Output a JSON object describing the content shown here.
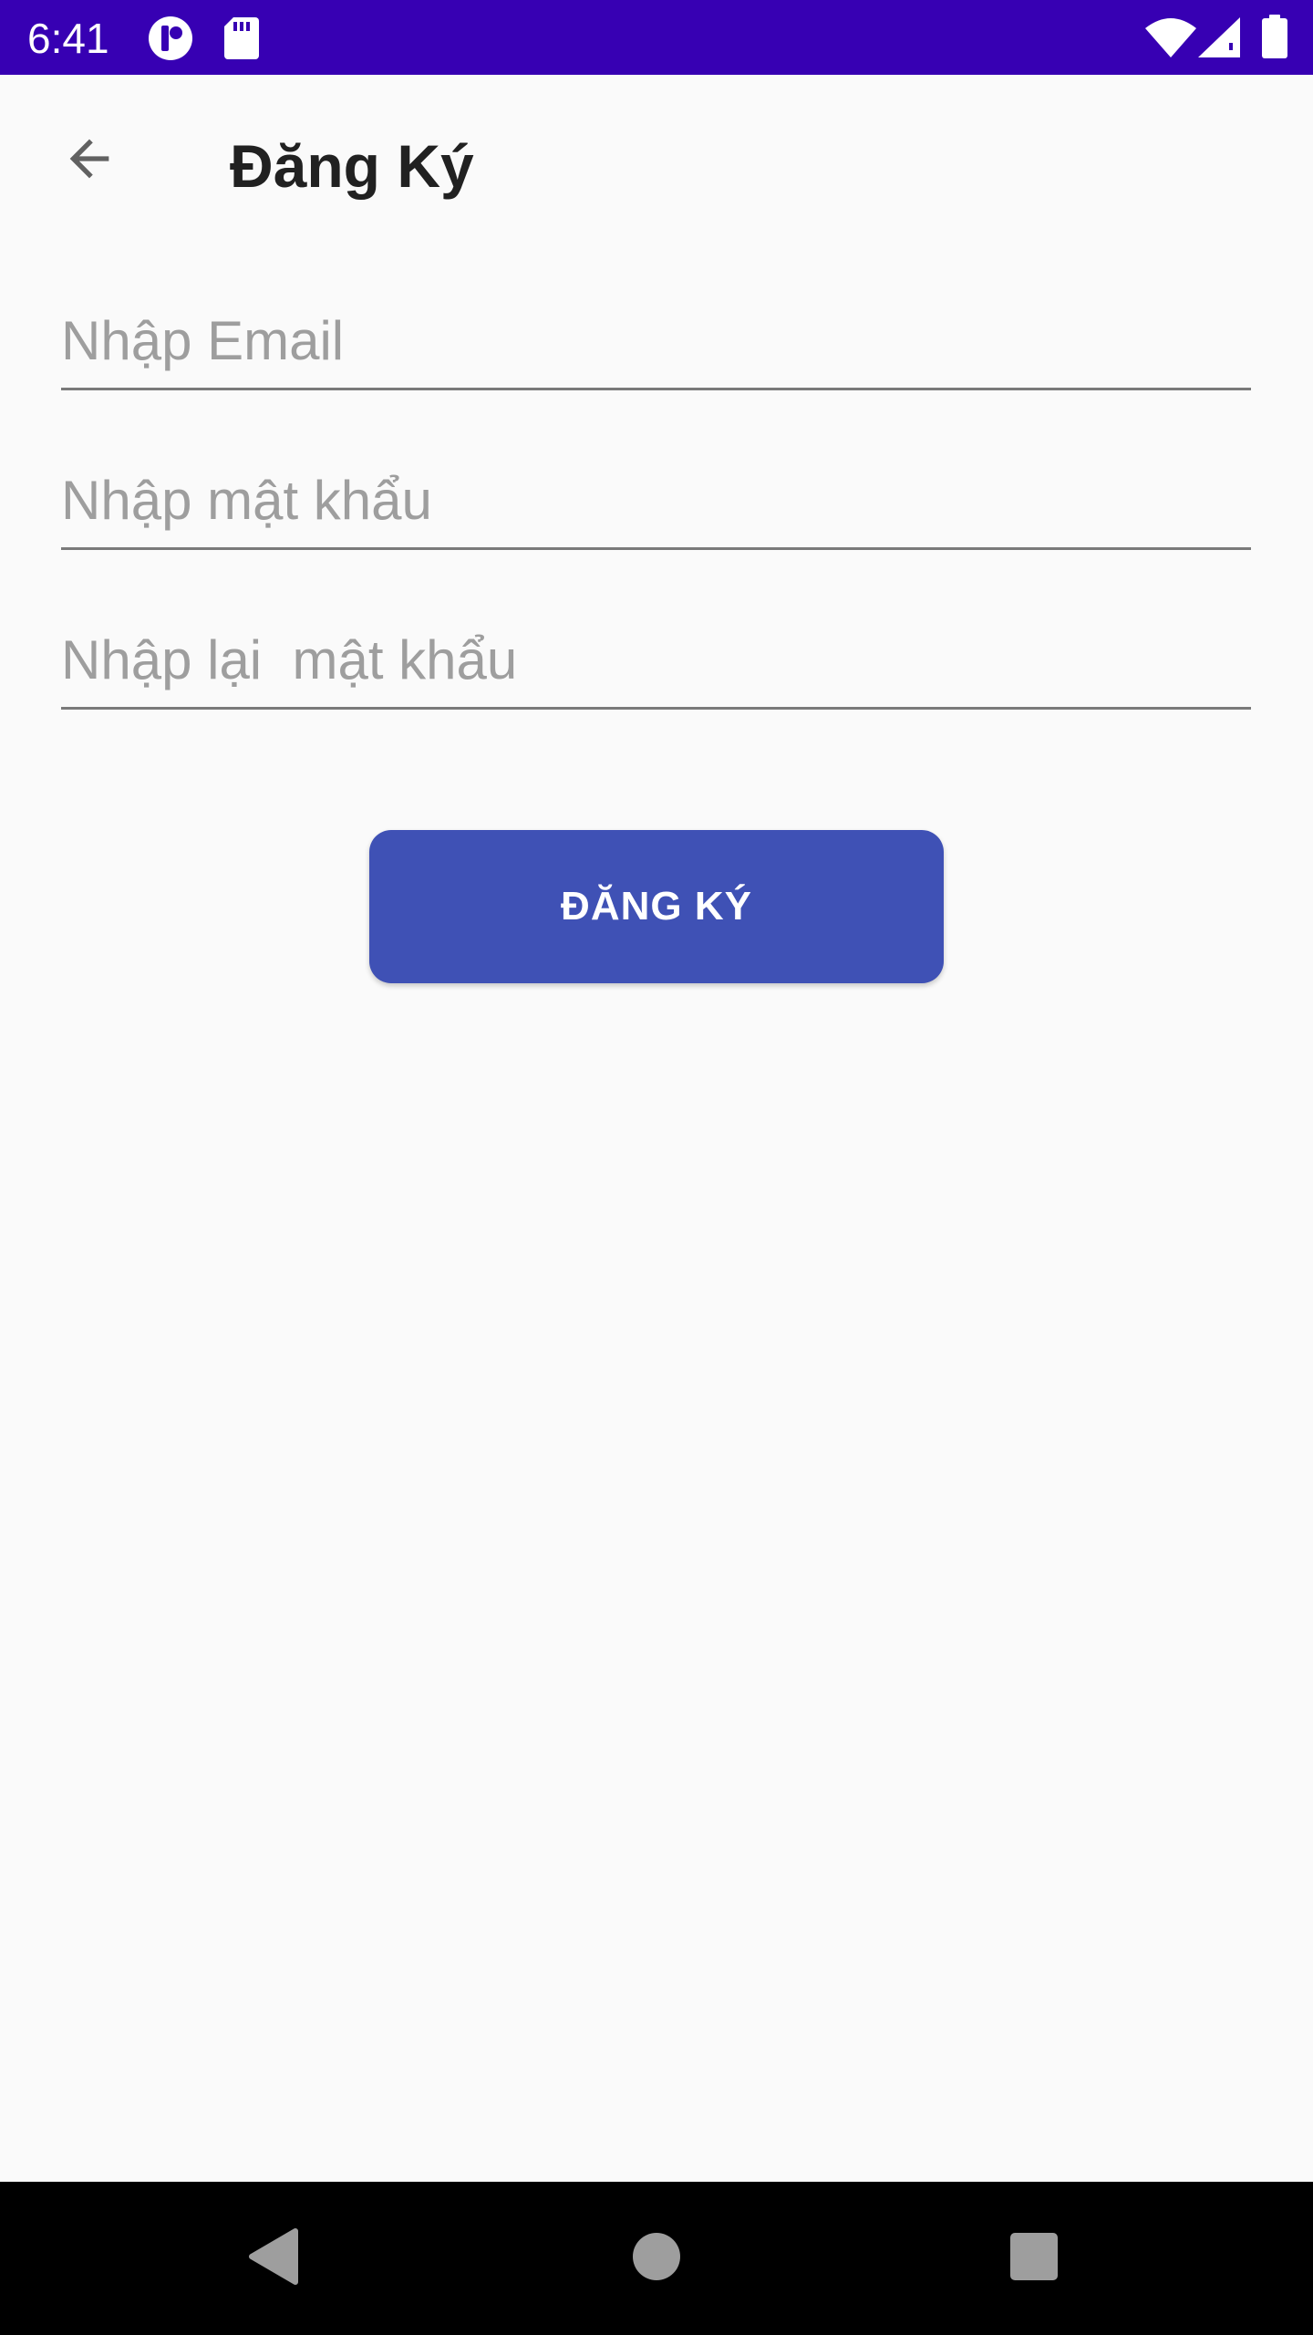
{
  "status_bar": {
    "time": "6:41",
    "background": "#3700b3",
    "icons": [
      "notification-app-icon",
      "sd-card-icon",
      "wifi-icon",
      "cellular-signal-icon",
      "battery-icon"
    ]
  },
  "app_bar": {
    "title": "Đăng Ký",
    "back_icon": "arrow-back-icon"
  },
  "form": {
    "email": {
      "value": "",
      "placeholder": "Nhập Email"
    },
    "password": {
      "value": "",
      "placeholder": "Nhập mật khẩu"
    },
    "confirm_password": {
      "value": "",
      "placeholder": "Nhập lại  mật khẩu"
    }
  },
  "register_button": {
    "label": "ĐĂNG KÝ",
    "color": "#3f51b5"
  },
  "nav_bar": {
    "buttons": [
      "back-triangle-icon",
      "home-circle-icon",
      "recents-square-icon"
    ]
  }
}
